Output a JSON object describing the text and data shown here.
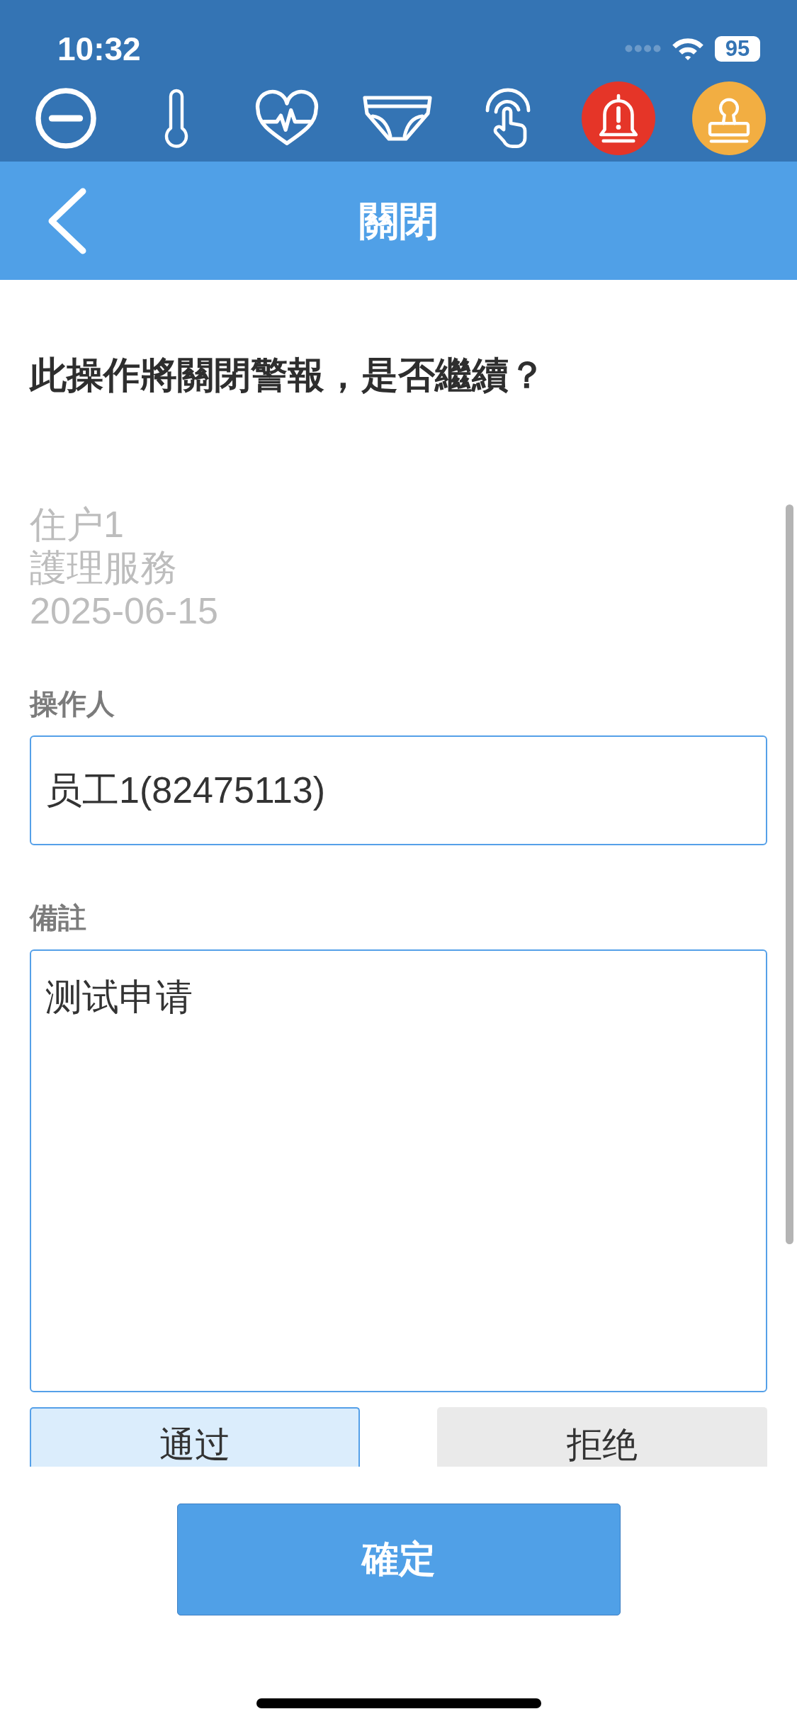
{
  "status_bar": {
    "time": "10:32",
    "battery": "95"
  },
  "nav_bar": {
    "title": "關閉"
  },
  "prompt": "此操作將關閉警報，是否繼續？",
  "alert_info": [
    "住户1",
    "護理服務",
    "2025-06-15"
  ],
  "form": {
    "fields": [
      {
        "kind": "input",
        "label": "操作人",
        "value": "员工1(82475113)"
      },
      {
        "kind": "textarea",
        "label": "備註",
        "value": "测试申请"
      }
    ],
    "choices": [
      {
        "label": "通过",
        "selected": true
      },
      {
        "label": "拒绝",
        "selected": false
      }
    ]
  },
  "confirm_button": {
    "label": "確定"
  }
}
